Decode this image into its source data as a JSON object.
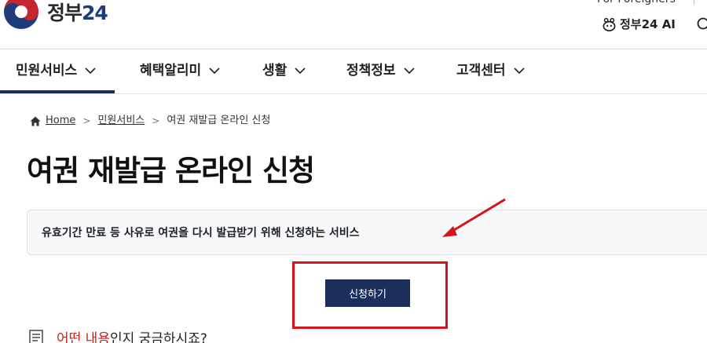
{
  "header": {
    "logo_text_prefix": "정부",
    "logo_text_number": "24",
    "foreigners_label": "For Foreigners",
    "ai_label": "정부24 AI"
  },
  "nav": {
    "items": [
      {
        "label": "민원서비스"
      },
      {
        "label": "혜택알리미"
      },
      {
        "label": "생활"
      },
      {
        "label": "정책정보"
      },
      {
        "label": "고객센터"
      }
    ]
  },
  "breadcrumb": {
    "home": "Home",
    "level1": "민원서비스",
    "current": "여권 재발급 온라인 신청"
  },
  "page": {
    "title": "여권 재발급 온라인 신청",
    "description": "유효기간 만료 등 사유로 여권을 다시 발급받기 위해 신청하는 서비스",
    "apply_button": "신청하기"
  },
  "faq": {
    "title_highlight": "어떤 내용",
    "title_rest": "인지 궁금하시죠?"
  },
  "colors": {
    "primary": "#1c2f5c",
    "annotation_red": "#d7141a",
    "desc_bg": "#f7f8fa"
  }
}
